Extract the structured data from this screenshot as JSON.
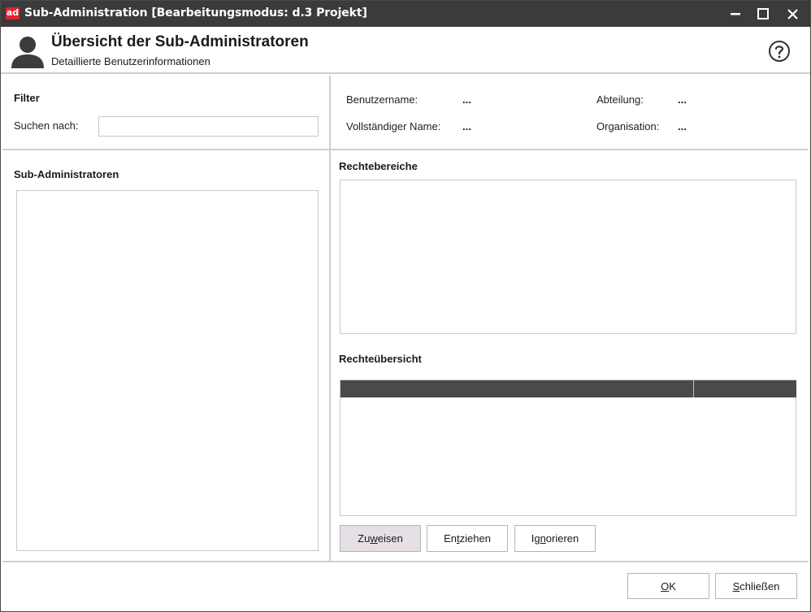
{
  "window": {
    "app_icon_text": "ad",
    "title": "Sub-Administration [Bearbeitungsmodus: d.3 Projekt]",
    "colors": {
      "titlebar": "#3b3b3b",
      "app_icon": "#e1232d",
      "grid_header": "#4a4a4a",
      "active_button": "#e6e0e6"
    }
  },
  "header": {
    "title": "Übersicht der Sub-Administratoren",
    "subtitle": "Detaillierte Benutzerinformationen",
    "icon": "user-icon",
    "help_icon": "help-icon"
  },
  "filter": {
    "heading": "Filter",
    "search_label": "Suchen nach:",
    "search_value": ""
  },
  "user_info": {
    "username_label": "Benutzername:",
    "username_value": "...",
    "fullname_label": "Vollständiger Name:",
    "fullname_value": "...",
    "department_label": "Abteilung:",
    "department_value": "...",
    "organisation_label": "Organisation:",
    "organisation_value": "..."
  },
  "subadmins": {
    "heading": "Sub-Administratoren",
    "items": []
  },
  "rights_areas": {
    "heading": "Rechtebereiche",
    "items": []
  },
  "rights_overview": {
    "heading": "Rechteübersicht",
    "columns": [
      "",
      ""
    ],
    "rows": []
  },
  "actions": {
    "assign_pre": "Zu",
    "assign_key": "w",
    "assign_post": "eisen",
    "revoke_pre": "En",
    "revoke_key": "t",
    "revoke_post": "ziehen",
    "ignore_pre": "Ig",
    "ignore_key": "n",
    "ignore_post": "orieren"
  },
  "footer": {
    "ok_key": "O",
    "ok_post": "K",
    "close_key": "S",
    "close_post": "chließen"
  }
}
